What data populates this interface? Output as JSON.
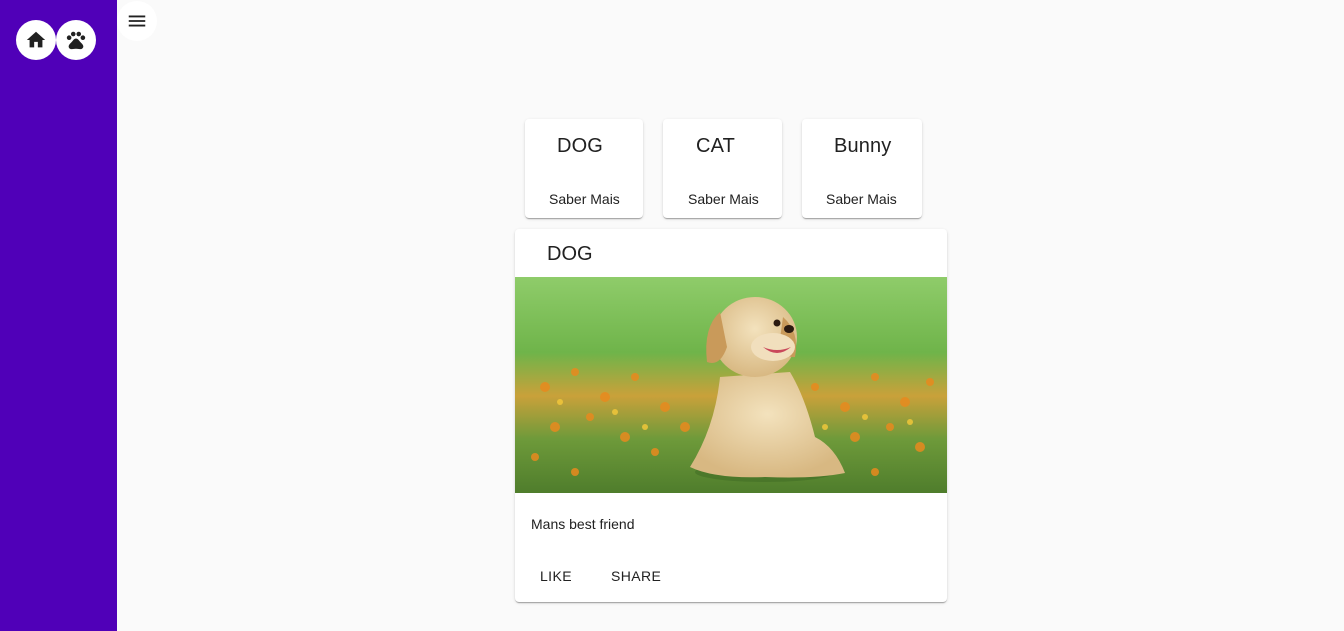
{
  "sidebar": {
    "buttons": [
      {
        "icon": "home-icon"
      },
      {
        "icon": "paw-icon"
      }
    ],
    "background": "#5000b8"
  },
  "toolbar": {
    "menu_icon": "menu-icon"
  },
  "animal_cards": [
    {
      "title": "DOG",
      "button": "Saber Mais"
    },
    {
      "title": "CAT",
      "button": "Saber Mais"
    },
    {
      "title": "Bunny",
      "button": "Saber Mais"
    }
  ],
  "detail_card": {
    "title": "DOG",
    "description": "Mans best friend",
    "actions": {
      "like": "LIKE",
      "share": "SHARE"
    }
  }
}
